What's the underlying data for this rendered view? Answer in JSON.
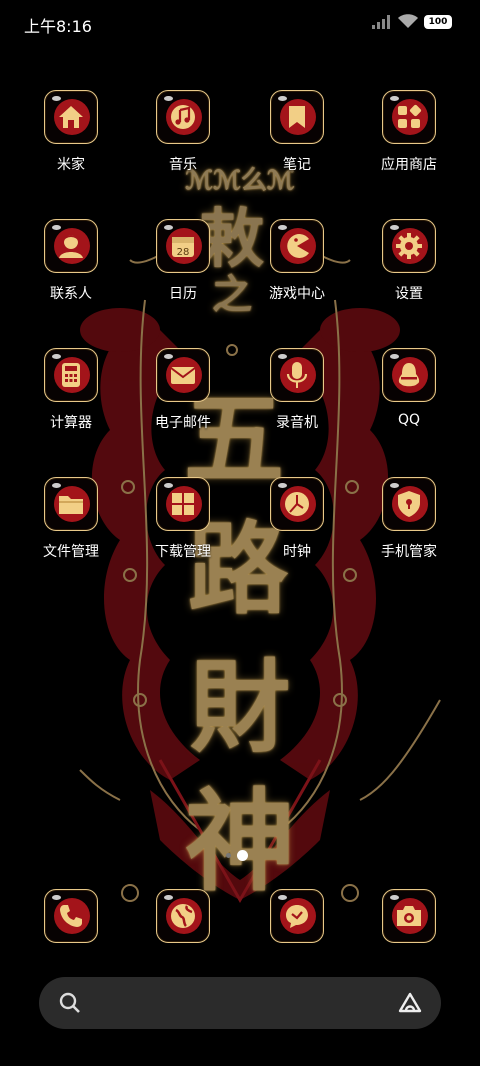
{
  "status_bar": {
    "time": "上午8:16",
    "battery": "100",
    "icons": [
      "signal-icon",
      "wifi-icon",
      "battery-icon"
    ]
  },
  "wallpaper": {
    "characters": [
      "敕",
      "之",
      "五",
      "路",
      "財",
      "神"
    ],
    "top_text": "ℳℳ么ℳ"
  },
  "apps": [
    {
      "label": "米家",
      "icon": "home-icon"
    },
    {
      "label": "音乐",
      "icon": "music-note-icon"
    },
    {
      "label": "笔记",
      "icon": "bookmark-icon"
    },
    {
      "label": "应用商店",
      "icon": "app-store-icon"
    },
    {
      "label": "联系人",
      "icon": "contacts-icon"
    },
    {
      "label": "日历",
      "icon": "calendar-icon",
      "badge": "28"
    },
    {
      "label": "游戏中心",
      "icon": "pacman-icon"
    },
    {
      "label": "设置",
      "icon": "gear-icon"
    },
    {
      "label": "计算器",
      "icon": "calculator-icon"
    },
    {
      "label": "电子邮件",
      "icon": "envelope-icon"
    },
    {
      "label": "录音机",
      "icon": "microphone-icon"
    },
    {
      "label": "QQ",
      "icon": "penguin-icon"
    },
    {
      "label": "文件管理",
      "icon": "folder-icon"
    },
    {
      "label": "下载管理",
      "icon": "download-grid-icon"
    },
    {
      "label": "时钟",
      "icon": "clock-icon"
    },
    {
      "label": "手机管家",
      "icon": "shield-lock-icon"
    }
  ],
  "dock": [
    {
      "icon": "phone-icon"
    },
    {
      "icon": "browser-globe-icon"
    },
    {
      "icon": "messages-icon"
    },
    {
      "icon": "camera-icon"
    }
  ],
  "pages": {
    "count": 2,
    "active": 2
  },
  "search": {
    "icons": [
      "search-icon",
      "assistant-icon"
    ]
  },
  "colors": {
    "icon_border": "#e8c98a",
    "icon_blob": "#a3141a",
    "icon_glyph": "#f2cf86",
    "wallpaper_gold": "#9a8152",
    "wallpaper_red": "#6e0d12"
  }
}
